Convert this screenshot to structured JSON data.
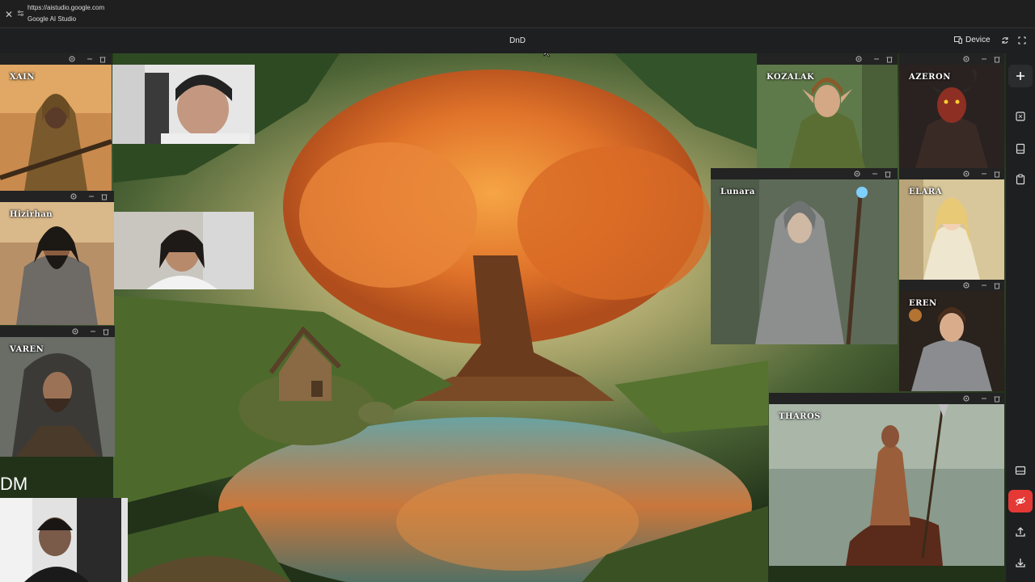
{
  "browser": {
    "url": "https://aistudio.google.com",
    "site_name": "Google AI Studio"
  },
  "app": {
    "title": "DnD",
    "device_label": "Device"
  },
  "characters": [
    {
      "id": "xain",
      "name": "XAIN"
    },
    {
      "id": "hizirhan",
      "name": "Hizirhan"
    },
    {
      "id": "varen",
      "name": "VAREN"
    },
    {
      "id": "kozalak",
      "name": "KOZALAK"
    },
    {
      "id": "azeron",
      "name": "AZERON"
    },
    {
      "id": "lunara",
      "name": "Lunara"
    },
    {
      "id": "elara",
      "name": "ELARA"
    },
    {
      "id": "eren",
      "name": "EREN"
    },
    {
      "id": "tharos",
      "name": "THAROS"
    }
  ],
  "dm": {
    "label": "DM"
  },
  "icons": {
    "panel_controls": [
      "gear-icon",
      "minimize-icon",
      "trash-icon"
    ],
    "rail_top": [
      "plus-icon",
      "crop-icon",
      "panel-icon",
      "clipboard-icon"
    ],
    "rail_bottom": [
      "panel-bottom-icon",
      "eye-off-icon",
      "upload-icon",
      "download-icon"
    ]
  },
  "colors": {
    "accent_red": "#e53935",
    "bar_bg": "#1e1f20"
  }
}
